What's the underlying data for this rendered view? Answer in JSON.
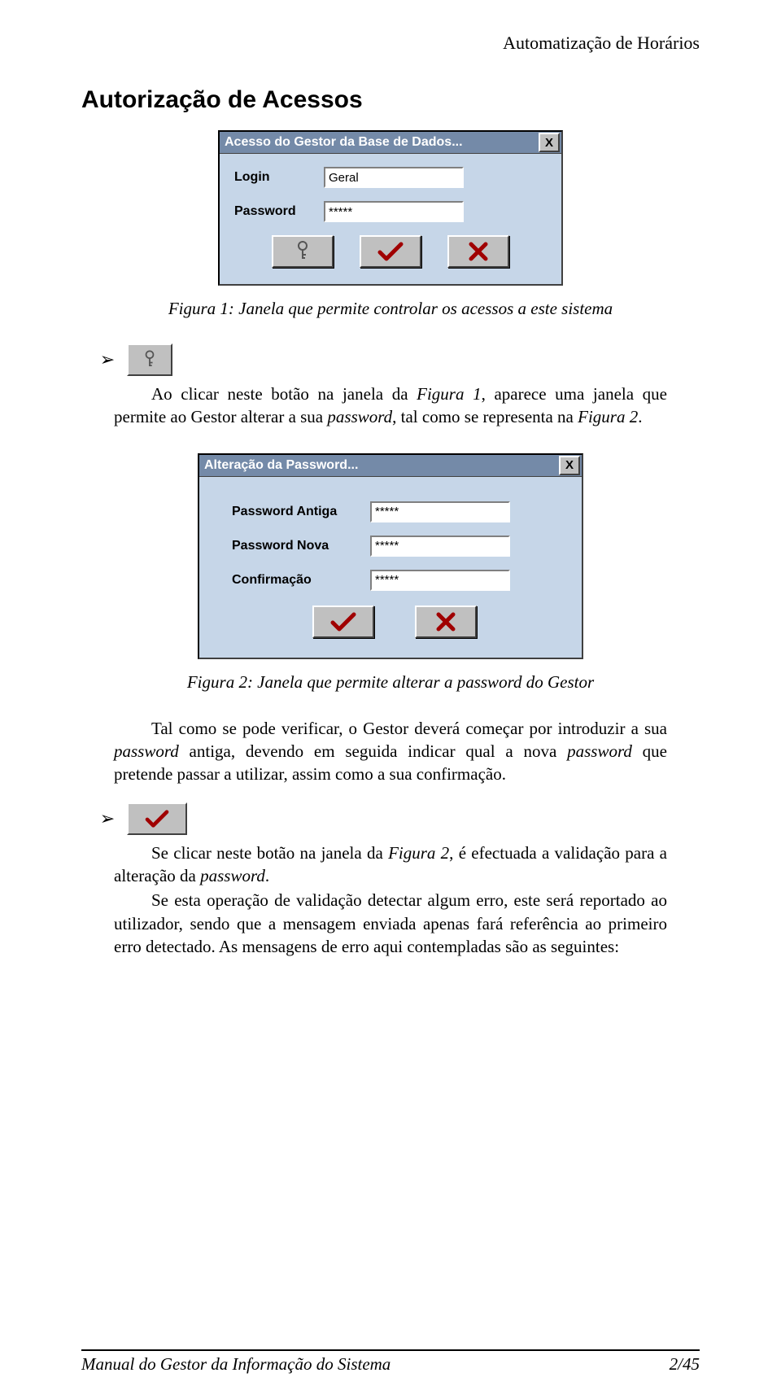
{
  "header": {
    "running_title": "Automatização de Horários"
  },
  "section": {
    "title": "Autorização de Acessos"
  },
  "dialog1": {
    "title": "Acesso do Gestor da Base de Dados...",
    "close_x": "X",
    "login_label": "Login",
    "login_value": "Geral",
    "password_label": "Password",
    "password_value": "*****"
  },
  "caption1": "Figura 1: Janela que permite controlar os acessos a este sistema",
  "para1": {
    "pre": "Ao clicar neste botão na janela da ",
    "fig_ref": "Figura 1",
    "mid": ", aparece uma janela que permite ao Gestor alterar a sua ",
    "pw_word": "password",
    "mid2": ", tal como se representa na ",
    "fig_ref2": "Figura 2",
    "end": "."
  },
  "dialog2": {
    "title": "Alteração da Password...",
    "close_x": "X",
    "old_label": "Password Antiga",
    "old_value": "*****",
    "new_label": "Password Nova",
    "new_value": "*****",
    "conf_label": "Confirmação",
    "conf_value": "*****"
  },
  "caption2": "Figura 2: Janela que permite alterar a password do Gestor",
  "para2": {
    "pre": "Tal como se pode verificar, o Gestor deverá começar por introduzir a sua ",
    "pw1": "password",
    "mid1": " antiga, devendo em seguida indicar qual a nova ",
    "pw2": "password",
    "mid2": " que pretende passar a utilizar, assim como a sua confirmação."
  },
  "para3": {
    "line1_pre": "Se clicar neste botão na janela da ",
    "fig_ref": "Figura 2",
    "line1_mid": ", é efectuada a validação para a alteração da ",
    "pw": "password",
    "line1_end": ".",
    "line2": "Se esta operação de validação detectar algum erro, este será reportado ao utilizador, sendo que a mensagem enviada apenas fará referência ao primeiro erro detectado. As mensagens de erro aqui contempladas são as seguintes:"
  },
  "footer": {
    "left": "Manual do Gestor da Informação do Sistema",
    "right": "2/45"
  },
  "bullet_glyph": "➢"
}
